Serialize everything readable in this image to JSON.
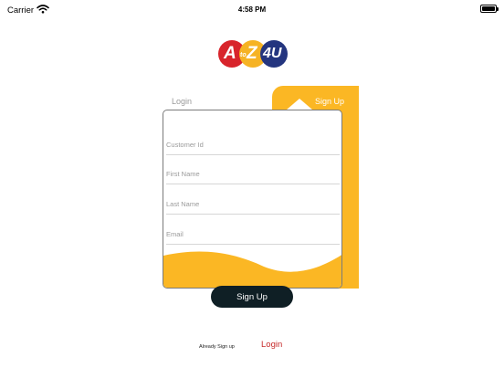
{
  "status_bar": {
    "carrier": "Carrier",
    "time": "4:58 PM",
    "wifi_icon": "wifi-icon",
    "battery_icon": "battery-icon"
  },
  "logo": {
    "a": "A",
    "to": "to",
    "z": "Z",
    "four_u": "4U",
    "colors": {
      "red": "#d8242b",
      "yellow": "#f6b324",
      "blue": "#24357f"
    }
  },
  "tabs": {
    "login_label": "Login",
    "signup_label": "Sign Up",
    "active": "Sign Up"
  },
  "form": {
    "customer_id": {
      "value": "",
      "placeholder": "Customer Id"
    },
    "first_name": {
      "value": "",
      "placeholder": "First Name"
    },
    "last_name": {
      "value": "",
      "placeholder": "Last Name"
    },
    "email": {
      "value": "",
      "placeholder": "Email"
    }
  },
  "signup_button_label": "Sign Up",
  "footer": {
    "already_text": "Already Sign up",
    "login_link": "Login"
  },
  "colors": {
    "accent_yellow": "#fbb724",
    "button_dark": "#0f1f25",
    "link_red": "#c62a2a"
  }
}
